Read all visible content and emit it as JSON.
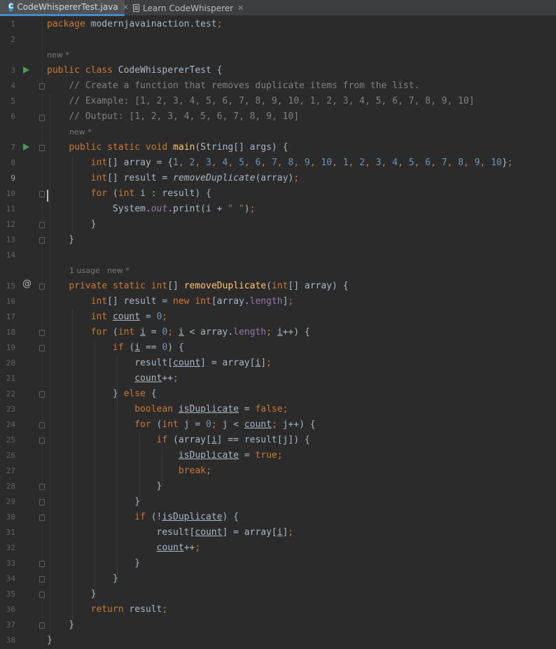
{
  "tabs": [
    {
      "label": "CodeWhispererTest.java",
      "icon": "class-icon",
      "active": true
    },
    {
      "label": "Learn CodeWhisperer",
      "icon": "document-icon",
      "active": false
    }
  ],
  "hints": {
    "class_author": "new *",
    "main_author": "new *",
    "remove_usage": "1 usage",
    "remove_author": "new *"
  },
  "current_line": "9",
  "lines": [
    {
      "n": "1",
      "t": "package modernjavainaction.test;"
    },
    {
      "n": "2",
      "t": ""
    },
    {
      "n": "3",
      "t": "public class CodeWhispererTest {"
    },
    {
      "n": "4",
      "t": "    // Create a function that removes duplicate items from the list."
    },
    {
      "n": "5",
      "t": "    // Example: [1, 2, 3, 4, 5, 6, 7, 8, 9, 10, 1, 2, 3, 4, 5, 6, 7, 8, 9, 10]"
    },
    {
      "n": "6",
      "t": "    // Output: [1, 2, 3, 4, 5, 6, 7, 8, 9, 10]"
    },
    {
      "n": "7",
      "t": "    public static void main(String[] args) {"
    },
    {
      "n": "8",
      "t": "        int[] array = {1, 2, 3, 4, 5, 6, 7, 8, 9, 10, 1, 2, 3, 4, 5, 6, 7, 8, 9, 10};"
    },
    {
      "n": "9",
      "t": "        int[] result = removeDuplicate(array);"
    },
    {
      "n": "10",
      "t": "        for (int i : result) {"
    },
    {
      "n": "11",
      "t": "            System.out.print(i + \" \");"
    },
    {
      "n": "12",
      "t": "        }"
    },
    {
      "n": "13",
      "t": "    }"
    },
    {
      "n": "14",
      "t": ""
    },
    {
      "n": "15",
      "t": "    private static int[] removeDuplicate(int[] array) {"
    },
    {
      "n": "16",
      "t": "        int[] result = new int[array.length];"
    },
    {
      "n": "17",
      "t": "        int count = 0;"
    },
    {
      "n": "18",
      "t": "        for (int i = 0; i < array.length; i++) {"
    },
    {
      "n": "19",
      "t": "            if (i == 0) {"
    },
    {
      "n": "20",
      "t": "                result[count] = array[i];"
    },
    {
      "n": "21",
      "t": "                count++;"
    },
    {
      "n": "22",
      "t": "            } else {"
    },
    {
      "n": "23",
      "t": "                boolean isDuplicate = false;"
    },
    {
      "n": "24",
      "t": "                for (int j = 0; j < count; j++) {"
    },
    {
      "n": "25",
      "t": "                    if (array[i] == result[j]) {"
    },
    {
      "n": "26",
      "t": "                        isDuplicate = true;"
    },
    {
      "n": "27",
      "t": "                        break;"
    },
    {
      "n": "28",
      "t": "                    }"
    },
    {
      "n": "29",
      "t": "                }"
    },
    {
      "n": "30",
      "t": "                if (!isDuplicate) {"
    },
    {
      "n": "31",
      "t": "                    result[count] = array[i];"
    },
    {
      "n": "32",
      "t": "                    count++;"
    },
    {
      "n": "33",
      "t": "                }"
    },
    {
      "n": "34",
      "t": "            }"
    },
    {
      "n": "35",
      "t": "        }"
    },
    {
      "n": "36",
      "t": "        return result;"
    },
    {
      "n": "37",
      "t": "    }"
    },
    {
      "n": "38",
      "t": "}"
    }
  ],
  "colors": {
    "background": "#2b2b2b",
    "keyword": "#cc7832",
    "method_declaration": "#ffc66d",
    "number": "#6897bb",
    "string": "#6a8759",
    "comment": "#808080",
    "field": "#9876aa",
    "run_marker": "#499c54"
  }
}
